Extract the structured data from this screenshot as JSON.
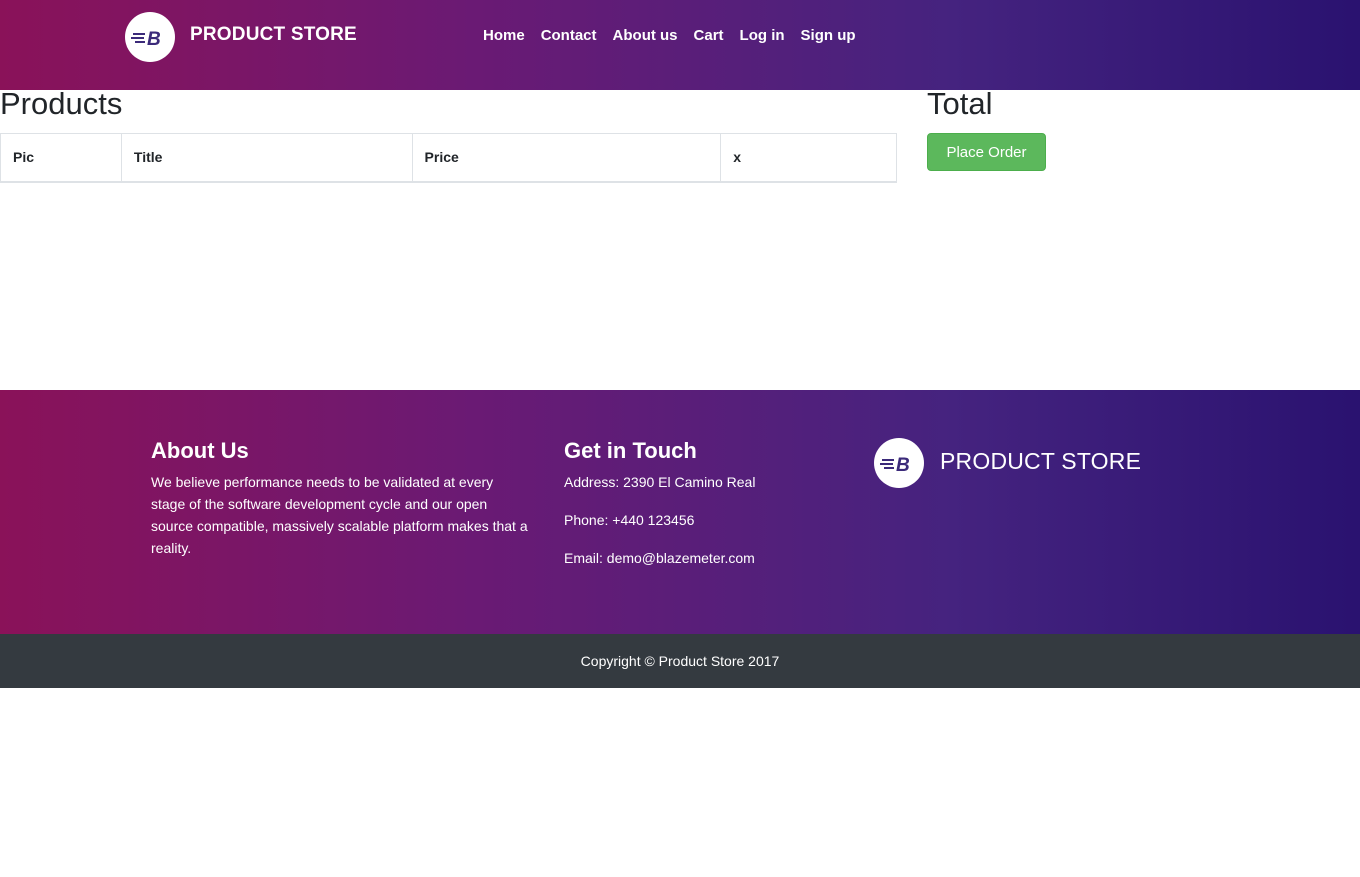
{
  "navbar": {
    "brand": "PRODUCT STORE",
    "logo_icon": "blazemeter-b-icon",
    "links": [
      "Home",
      "Contact",
      "About us",
      "Cart",
      "Log in",
      "Sign up"
    ]
  },
  "main": {
    "products_heading": "Products",
    "table_headers": [
      "Pic",
      "Title",
      "Price",
      "x"
    ],
    "total_heading": "Total",
    "place_order_label": "Place Order"
  },
  "footer": {
    "about_title": "About Us",
    "about_text": "We believe performance needs to be validated at every stage of the software development cycle and our open source compatible, massively scalable platform makes that a reality.",
    "touch_title": "Get in Touch",
    "address": "Address: 2390 El Camino Real",
    "phone": "Phone: +440 123456",
    "email": "Email: demo@blazemeter.com",
    "brand": "PRODUCT STORE",
    "copyright": "Copyright © Product Store 2017"
  },
  "colors": {
    "gradient_start": "#8a1259",
    "gradient_end": "#2a1270",
    "place_order_bg": "#5cb85c",
    "copyright_bg": "#343a40"
  }
}
